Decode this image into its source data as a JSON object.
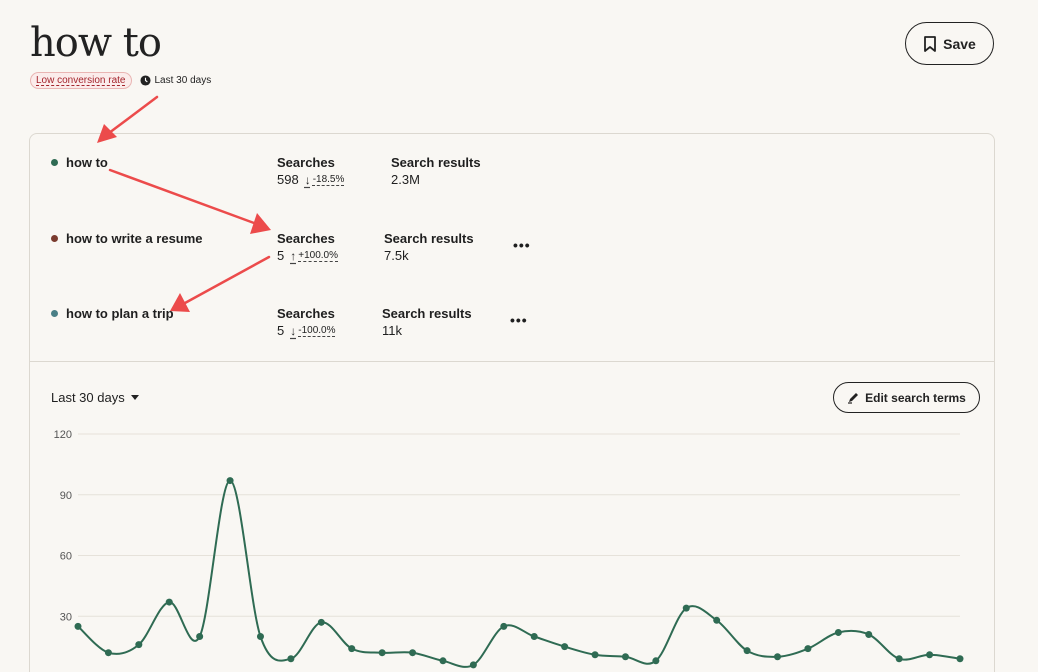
{
  "header": {
    "title": "how to",
    "badge": "Low conversion rate",
    "period": "Last 30 days",
    "save_label": "Save"
  },
  "terms": [
    {
      "name": "how to",
      "color": "#2f6b53",
      "searches_label": "Searches",
      "searches": "598",
      "change": "-18.5%",
      "direction": "down",
      "results_label": "Search results",
      "results": "2.3M"
    },
    {
      "name": "how to write a resume",
      "color": "#7a3b2e",
      "searches_label": "Searches",
      "searches": "5",
      "change": "+100.0%",
      "direction": "up",
      "results_label": "Search results",
      "results": "7.5k"
    },
    {
      "name": "how to plan a trip",
      "color": "#4a7f86",
      "searches_label": "Searches",
      "searches": "5",
      "change": "-100.0%",
      "direction": "down",
      "results_label": "Search results",
      "results": "11k"
    }
  ],
  "more_label": "•••",
  "controls": {
    "range_label": "Last 30 days",
    "edit_label": "Edit search terms"
  },
  "chart_data": {
    "type": "line",
    "y_ticks": [
      "120",
      "90",
      "60",
      "30"
    ],
    "ylim": [
      0,
      120
    ],
    "grid": true,
    "series": [
      {
        "color": "#2f6b53",
        "values": [
          25,
          12,
          16,
          37,
          20,
          97,
          20,
          9,
          27,
          14,
          12,
          12,
          8,
          6,
          25,
          20,
          15,
          11,
          10,
          8,
          34,
          28,
          13,
          10,
          14,
          22,
          21,
          9,
          11,
          9
        ]
      }
    ]
  },
  "annotation_color": "#ec4b4b"
}
